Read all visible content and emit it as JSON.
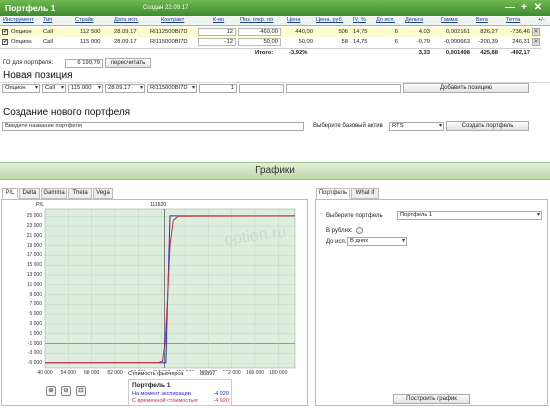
{
  "header": {
    "title": "Портфель 1",
    "created": "Создан 22.09.17"
  },
  "window_controls": {
    "min": "—",
    "add": "+",
    "close": "✕",
    "expand": "+/-"
  },
  "table": {
    "columns": [
      "Инструмент",
      "Тип",
      "Страйк",
      "Дата исп.",
      "Контракт",
      "К-во",
      "Поз. откр. по",
      "Цена",
      "Цена, руб.",
      "IV, %",
      "До исп.",
      "Дельта",
      "Гамма",
      "Вега",
      "Тетта"
    ],
    "rows": [
      {
        "instrument": "Опцион",
        "type": "Call",
        "strike": "112 500",
        "date": "28.09.17",
        "contract": "RI112500BI7D",
        "qty": "12",
        "open_price": "460,00",
        "price": "440,00",
        "price_rub": "506",
        "iv": "14,75",
        "days": "6",
        "delta": "4,03",
        "gamma": "0,002161",
        "vega": "826,27",
        "theta": "-736,46"
      },
      {
        "instrument": "Опцион",
        "type": "Call",
        "strike": "115 000",
        "date": "28.09.17",
        "contract": "RI115000BI7D",
        "qty": "-12",
        "open_price": "50,00",
        "price": "50,00",
        "price_rub": "58",
        "iv": "14,75",
        "days": "6",
        "delta": "-0,70",
        "gamma": "-0,000663",
        "vega": "-200,39",
        "theta": "246,31"
      }
    ],
    "totals": {
      "label": "Итого:",
      "pct": "-3,92%",
      "delta": "3,33",
      "gamma": "0,001498",
      "vega": "425,88",
      "theta": "-492,17"
    }
  },
  "go": {
    "label": "ГО для портфеля:",
    "value": "6 199,79",
    "recalc": "пересчитать"
  },
  "new_position": {
    "title": "Новая позиция",
    "instrument": "Опцион",
    "type": "Call",
    "strike": "115 000",
    "date": "28.09.17",
    "contract": "RI115000BI7D",
    "qty": "1",
    "add": "Добавить позицию"
  },
  "create": {
    "title": "Создание нового портфеля",
    "name_placeholder": "Введите название портфеля",
    "base_label": "Выберите базовый актив",
    "base": "RTS",
    "button": "Создать портфель"
  },
  "graphs": {
    "title": "Графики"
  },
  "chart_tabs": [
    "P/L",
    "Delta",
    "Gamma",
    "Theta",
    "Vega"
  ],
  "chart_data": {
    "type": "line",
    "title": "",
    "ylabel": "P/L",
    "xlabel": "Стоимость фьючерса",
    "x_ticks": [
      "40 000",
      "54 000",
      "68 000",
      "82 000",
      "96 000",
      "110 000",
      "124 000",
      "138 000",
      "152 000",
      "166 000",
      "180 000"
    ],
    "y_ticks": [
      "25 000",
      "23 000",
      "21 000",
      "19 000",
      "17 000",
      "15 000",
      "13 000",
      "11 000",
      "9 000",
      "7 000",
      "5 000",
      "3 000",
      "1 000",
      "-1 000",
      "-3 000",
      "-5 000"
    ],
    "xlim": [
      40000,
      190000
    ],
    "ylim": [
      -6000,
      26500
    ],
    "marker": {
      "label": "111620",
      "x": 111620
    },
    "current_label": "86897",
    "watermark": "option.ru",
    "series": [
      {
        "name": "На момент экспирации",
        "color": "#2b2bcc",
        "x": [
          40000,
          112500,
          115000,
          190000
        ],
        "y": [
          -4920,
          -4920,
          25080,
          25080
        ]
      },
      {
        "name": "С временной стоимостью",
        "color": "#cc2b4b",
        "x": [
          40000,
          108000,
          110500,
          112000,
          113500,
          115000,
          117000,
          120000,
          190000
        ],
        "y": [
          -4920,
          -4900,
          -4600,
          -1000,
          8000,
          19000,
          24200,
          25000,
          25080
        ]
      }
    ],
    "legend": {
      "title": "Портфель 1",
      "values": [
        "-4 920",
        "-4 920"
      ]
    }
  },
  "zoom": [
    "⊕",
    "⊖",
    "⊡"
  ],
  "right_tabs": [
    "Портфель",
    "What if"
  ],
  "right_panel": {
    "portfolio_label": "Выберите портфель",
    "portfolio": "Портфель 1",
    "rub_label": "В рублях:",
    "until_label": "До исп.:",
    "until": "В днях",
    "build": "Построить график"
  }
}
